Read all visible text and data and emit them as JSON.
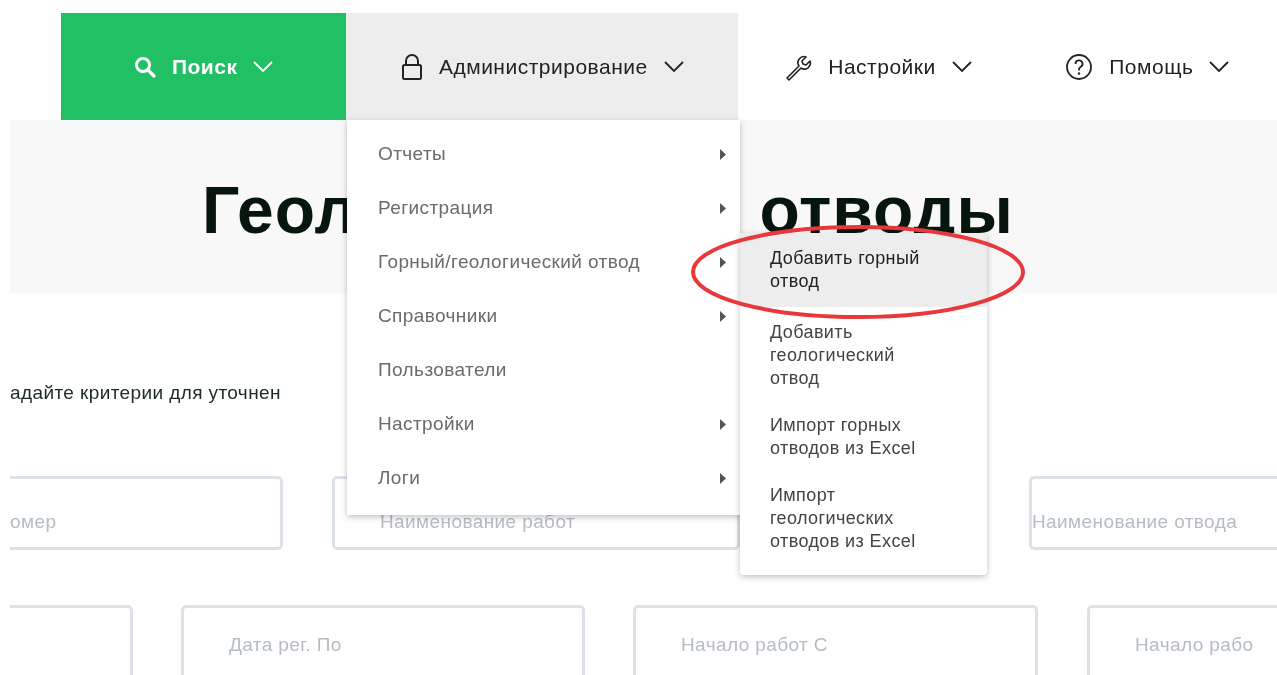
{
  "nav": [
    {
      "label": "Поиск",
      "kind": "primary",
      "selected": false
    },
    {
      "label": "Администрирование",
      "kind": "normal",
      "selected": true
    },
    {
      "label": "Настройки",
      "kind": "normal",
      "selected": false
    },
    {
      "label": "Помощь",
      "kind": "normal",
      "selected": false
    }
  ],
  "hero": {
    "title_left": "Геол",
    "title_right": "отводы"
  },
  "hint": "адайте критерии для уточнен",
  "fields_row_1": [
    {
      "placeholder": "омер"
    },
    {
      "placeholder": "Наименование работ"
    },
    {
      "placeholder": "Наименование отвода"
    }
  ],
  "fields_row_2": [
    {
      "placeholder": "Дата рег. По"
    },
    {
      "placeholder": "Начало работ С"
    },
    {
      "placeholder": "Начало рабо"
    }
  ],
  "menu": [
    {
      "label": "Отчеты",
      "has_submenu": true
    },
    {
      "label": "Регистрация",
      "has_submenu": true
    },
    {
      "label": "Горный/геологический отвод",
      "has_submenu": true
    },
    {
      "label": "Справочники",
      "has_submenu": true
    },
    {
      "label": "Пользователи",
      "has_submenu": false
    },
    {
      "label": "Настройки",
      "has_submenu": true
    },
    {
      "label": "Логи",
      "has_submenu": true
    }
  ],
  "submenu": [
    {
      "label": "Добавить горный отвод",
      "selected": true
    },
    {
      "label": "Добавить геологический отвод",
      "selected": false
    },
    {
      "label": "Импорт горных отводов из Excel",
      "selected": false
    },
    {
      "label": "Импорт геологических отводов из Excel",
      "selected": false
    }
  ]
}
